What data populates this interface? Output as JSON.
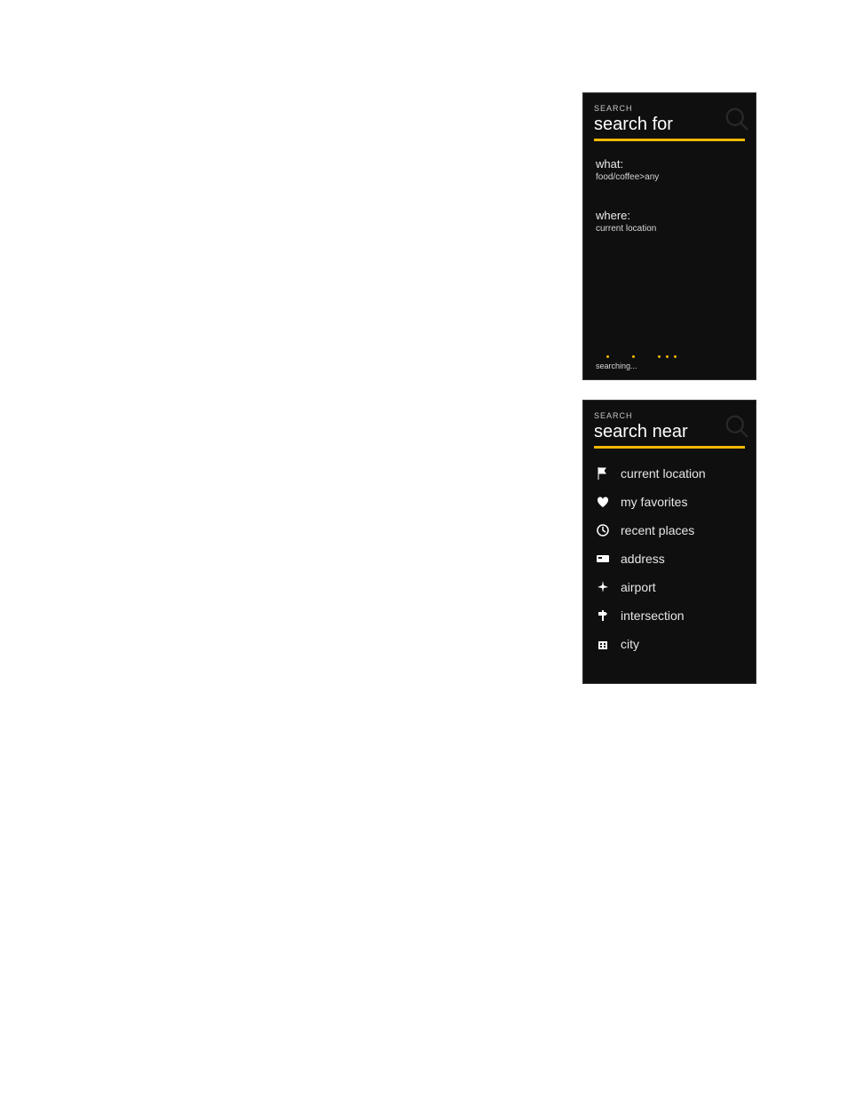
{
  "colors": {
    "accent": "#f0b800",
    "bg": "#0f0f0f"
  },
  "screen1": {
    "kicker": "SEARCH",
    "title": "search for",
    "fields": {
      "what_label": "what:",
      "what_value": "food/coffee>any",
      "where_label": "where:",
      "where_value": "current location"
    },
    "loading_text": "searching..."
  },
  "screen2": {
    "kicker": "SEARCH",
    "title": "search near",
    "items": [
      {
        "icon": "flag-icon",
        "label": "current location"
      },
      {
        "icon": "heart-icon",
        "label": "my favorites"
      },
      {
        "icon": "clock-icon",
        "label": "recent places"
      },
      {
        "icon": "card-icon",
        "label": "address"
      },
      {
        "icon": "airplane-icon",
        "label": "airport"
      },
      {
        "icon": "signpost-icon",
        "label": "intersection"
      },
      {
        "icon": "building-icon",
        "label": "city"
      }
    ]
  }
}
